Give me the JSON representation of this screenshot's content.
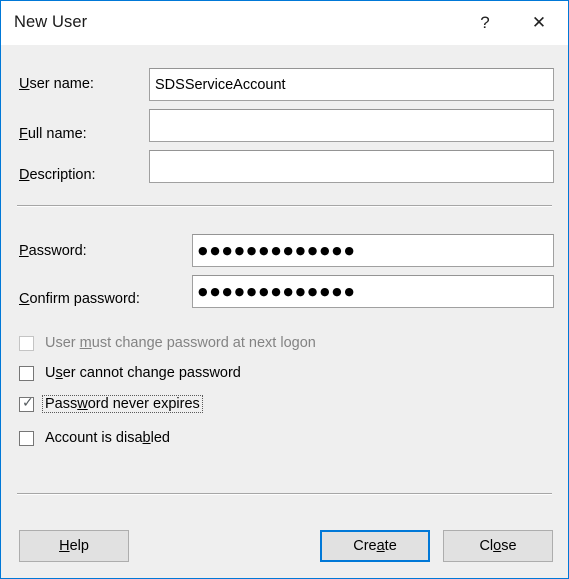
{
  "window": {
    "title": "New User",
    "accent_color": "#0078d7",
    "body_background": "#efefef",
    "titlebar_background": "#ffffff",
    "help_icon": "question-mark-icon",
    "close_icon": "close-icon",
    "help_glyph": "?",
    "close_glyph": "✕"
  },
  "fields": [
    {
      "label_pre": "",
      "label_accel": "U",
      "label_post": "ser name:",
      "value": "SDSServiceAccount",
      "placeholder": "",
      "type": "text"
    },
    {
      "label_pre": "",
      "label_accel": "F",
      "label_post": "ull name:",
      "value": "",
      "placeholder": "",
      "type": "text"
    },
    {
      "label_pre": "",
      "label_accel": "D",
      "label_post": "escription:",
      "value": "",
      "placeholder": "",
      "type": "text"
    }
  ],
  "password_fields": [
    {
      "label_pre": "",
      "label_accel": "P",
      "label_post": "assword:",
      "masked_value": "●●●●●●●●●●●●●",
      "char_count": 13,
      "type": "password"
    },
    {
      "label_pre": "",
      "label_accel": "C",
      "label_post": "onfirm password:",
      "masked_value": "●●●●●●●●●●●●●",
      "char_count": 13,
      "type": "password"
    }
  ],
  "checkboxes": [
    {
      "text_pre": "User ",
      "accel": "m",
      "text_post": "ust change password at next logon",
      "checked": false,
      "disabled": true,
      "focused": false,
      "check_glyph": ""
    },
    {
      "text_pre": "U",
      "accel": "s",
      "text_post": "er cannot change password",
      "checked": false,
      "disabled": false,
      "focused": false,
      "check_glyph": ""
    },
    {
      "text_pre": "Pass",
      "accel": "w",
      "text_post": "ord never expires",
      "checked": true,
      "disabled": false,
      "focused": true,
      "check_glyph": "✓"
    },
    {
      "text_pre": "Account is disa",
      "accel": "b",
      "text_post": "led",
      "checked": false,
      "disabled": false,
      "focused": false,
      "check_glyph": ""
    }
  ],
  "buttons": {
    "help": {
      "pre": "",
      "accel": "H",
      "post": "elp",
      "default": false
    },
    "create": {
      "pre": "Cre",
      "accel": "a",
      "post": "te",
      "default": true
    },
    "close": {
      "pre": "Cl",
      "accel": "o",
      "post": "se",
      "default": false
    }
  }
}
